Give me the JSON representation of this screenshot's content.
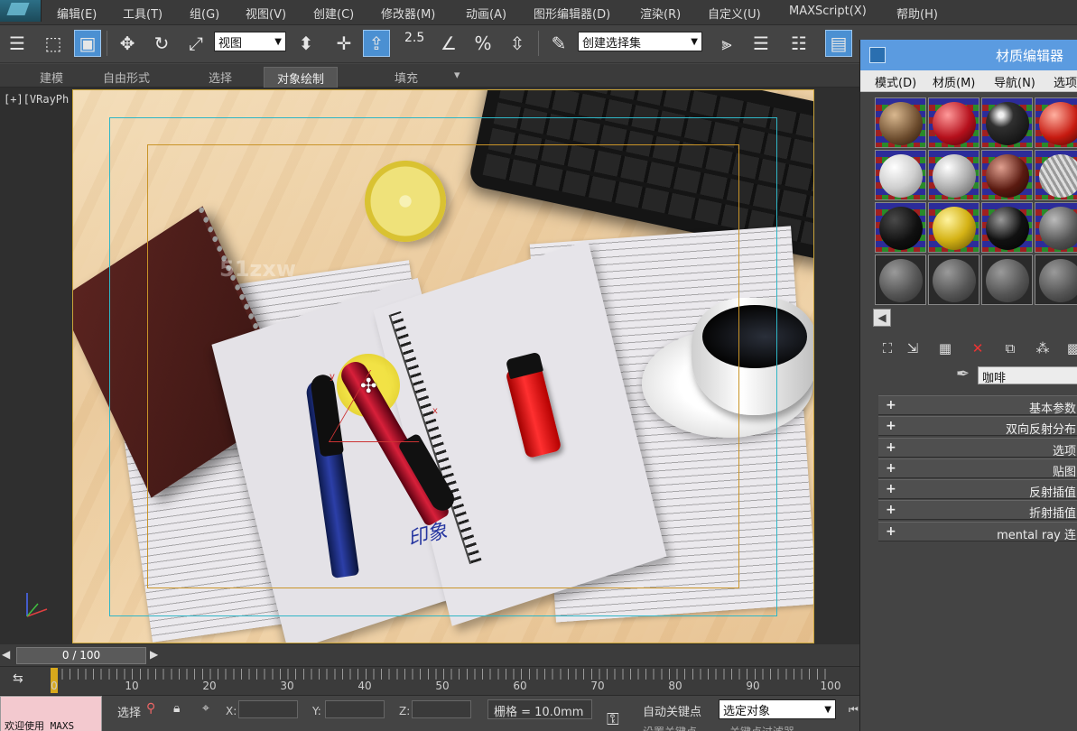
{
  "menubar": {
    "items": [
      "编辑(E)",
      "工具(T)",
      "组(G)",
      "视图(V)",
      "创建(C)",
      "修改器(M)",
      "动画(A)",
      "图形编辑器(D)",
      "渲染(R)",
      "自定义(U)",
      "MAXScript(X)",
      "帮助(H)"
    ]
  },
  "toolbar": {
    "view_dropdown": "视图",
    "spinner_value": "2.5",
    "selection_set": "创建选择集"
  },
  "ribbon": {
    "tabs": [
      "建模",
      "自由形式",
      "选择",
      "对象绘制",
      "填充"
    ],
    "active_tab": "对象绘制"
  },
  "viewport": {
    "label": "[+][VRayPh",
    "watermark": "51zxw",
    "handwriting": "印象"
  },
  "material_editor": {
    "title": "材质编辑器",
    "menus": [
      "模式(D)",
      "材质(M)",
      "导航(N)",
      "选项"
    ],
    "material_name": "咖啡",
    "rollouts": [
      "基本参数",
      "双向反射分布",
      "选项",
      "贴图",
      "反射插值",
      "折射插值",
      "mental ray 连"
    ]
  },
  "timeslider": {
    "frame_display": "0 / 100",
    "ticks": [
      "0",
      "10",
      "20",
      "30",
      "40",
      "50",
      "60",
      "70",
      "80",
      "90",
      "100"
    ]
  },
  "statusbar": {
    "welcome": "欢迎使用 MAXS",
    "selection_label": "选择",
    "x_label": "X:",
    "y_label": "Y:",
    "z_label": "Z:",
    "grid": "栅格 = 10.0mm",
    "auto_key": "自动关键点",
    "selected_object": "选定对象",
    "set_key": "设置关键点",
    "key_filter": "关键点过滤器"
  }
}
